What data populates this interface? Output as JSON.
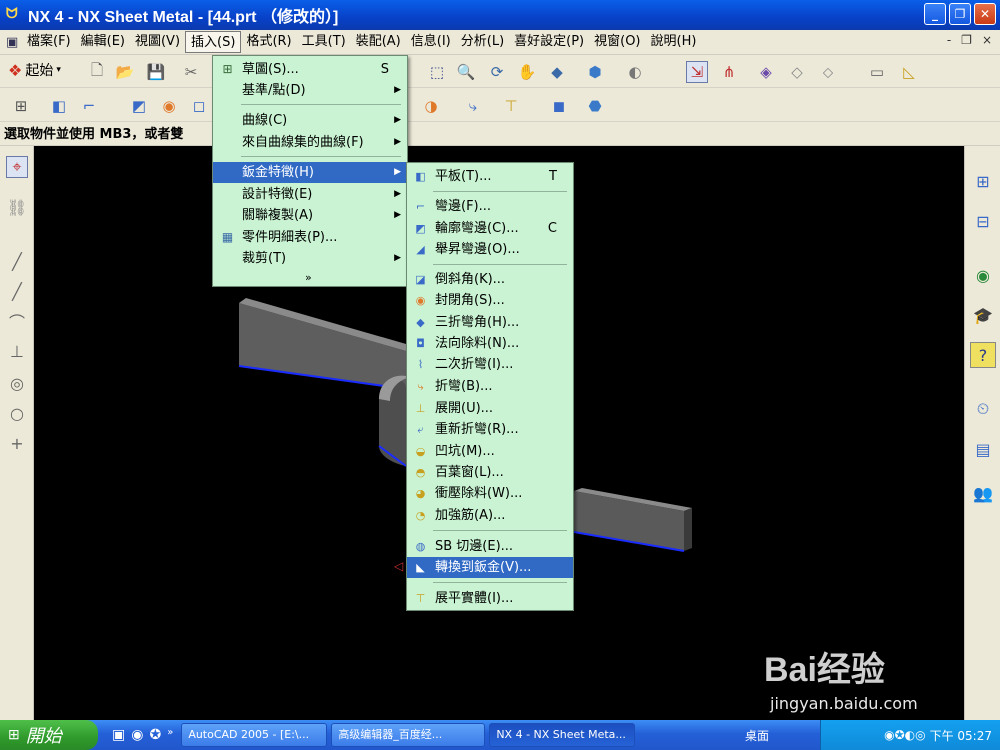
{
  "window": {
    "title": "NX 4 - NX Sheet Metal - [44.prt （修改的）]",
    "min": "_",
    "max": "❐",
    "close": "✕"
  },
  "menubar": {
    "items": [
      "檔案(F)",
      "編輯(E)",
      "視圖(V)",
      "插入(S)",
      "格式(R)",
      "工具(T)",
      "裝配(A)",
      "信息(I)",
      "分析(L)",
      "喜好設定(P)",
      "視窗(O)",
      "說明(H)"
    ],
    "mdi": [
      "-",
      "❐",
      "×"
    ]
  },
  "toolbar": {
    "start_label": "起始"
  },
  "prompt": "選取物件並使用 MB3，或者雙",
  "insert_menu": {
    "items": [
      {
        "label": "草圖(S)...",
        "shortcut": "S",
        "icon": "sketch-icon"
      },
      {
        "label": "基準/點(D)",
        "arrow": "▶"
      },
      {
        "label": "曲線(C)",
        "arrow": "▶"
      },
      {
        "label": "來自曲線集的曲線(F)",
        "arrow": "▶"
      },
      {
        "label": "鈑金特徵(H)",
        "arrow": "▶"
      },
      {
        "label": "設計特徵(E)",
        "arrow": "▶"
      },
      {
        "label": "關聯複製(A)",
        "arrow": "▶"
      },
      {
        "label": "零件明細表(P)...",
        "icon": "table-icon"
      },
      {
        "label": "裁剪(T)",
        "arrow": "▶"
      }
    ],
    "more": "»"
  },
  "sheet_metal_menu": {
    "items": [
      {
        "label": "平板(T)...",
        "shortcut": "T"
      },
      {
        "label": "彎邊(F)..."
      },
      {
        "label": "輪廓彎邊(C)...",
        "shortcut": "C"
      },
      {
        "label": "舉昇彎邊(O)..."
      },
      {
        "label": "倒斜角(K)..."
      },
      {
        "label": "封閉角(S)..."
      },
      {
        "label": "三折彎角(H)..."
      },
      {
        "label": "法向除料(N)..."
      },
      {
        "label": "二次折彎(I)..."
      },
      {
        "label": "折彎(B)..."
      },
      {
        "label": "展開(U)..."
      },
      {
        "label": "重新折彎(R)..."
      },
      {
        "label": "凹坑(M)..."
      },
      {
        "label": "百葉窗(L)..."
      },
      {
        "label": "衝壓除料(W)..."
      },
      {
        "label": "加強筋(A)..."
      },
      {
        "label": "SB 切邊(E)..."
      },
      {
        "label": "轉換到鈑金(V)..."
      },
      {
        "label": "展平實體(I)..."
      }
    ]
  },
  "taskbar": {
    "start": "開始",
    "tasks": [
      "AutoCAD 2005 - [E:\\...",
      "高级编辑器_百度经...",
      "NX 4 - NX Sheet Meta..."
    ],
    "desktop": "桌面",
    "time": "下午 05:27"
  },
  "watermark": {
    "brand": "Bai经验",
    "url": "jingyan.baidu.com"
  },
  "colors": {
    "highlight": "#316ac5",
    "menu_bg": "#c9f3d2",
    "part_edge": "#1a2cff"
  }
}
